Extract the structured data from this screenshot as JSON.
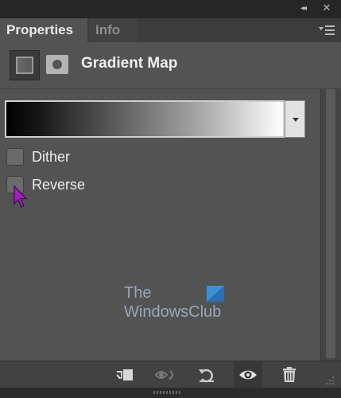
{
  "window": {
    "collapse_glyph": "◂◂",
    "close_glyph": "✕"
  },
  "tabs": [
    {
      "label": "Properties",
      "active": true
    },
    {
      "label": "Info",
      "active": false
    }
  ],
  "header": {
    "title": "Gradient Map",
    "adjustment_icon": "gradient-map-adjustment-icon",
    "mask_icon": "layer-mask-icon"
  },
  "gradient": {
    "stops": [
      "#000000",
      "#ffffff"
    ]
  },
  "options": {
    "dither": {
      "label": "Dither",
      "checked": false
    },
    "reverse": {
      "label": "Reverse",
      "checked": false
    }
  },
  "watermark": {
    "line1": "The",
    "line2": "WindowsClub"
  },
  "toolbar": {
    "buttons": [
      {
        "name": "clip-to-layer",
        "icon": "clip-to-layer-icon",
        "enabled": true
      },
      {
        "name": "view-previous-state",
        "icon": "view-previous-state-icon",
        "enabled": false
      },
      {
        "name": "reset",
        "icon": "reset-icon",
        "enabled": true
      },
      {
        "name": "toggle-visibility",
        "icon": "eye-icon",
        "enabled": true
      },
      {
        "name": "delete",
        "icon": "trash-icon",
        "enabled": true
      }
    ]
  },
  "colors": {
    "panel_bg": "#535353",
    "tab_active": "#535353",
    "tab_inactive": "#424242",
    "cursor": "#a020c0"
  }
}
